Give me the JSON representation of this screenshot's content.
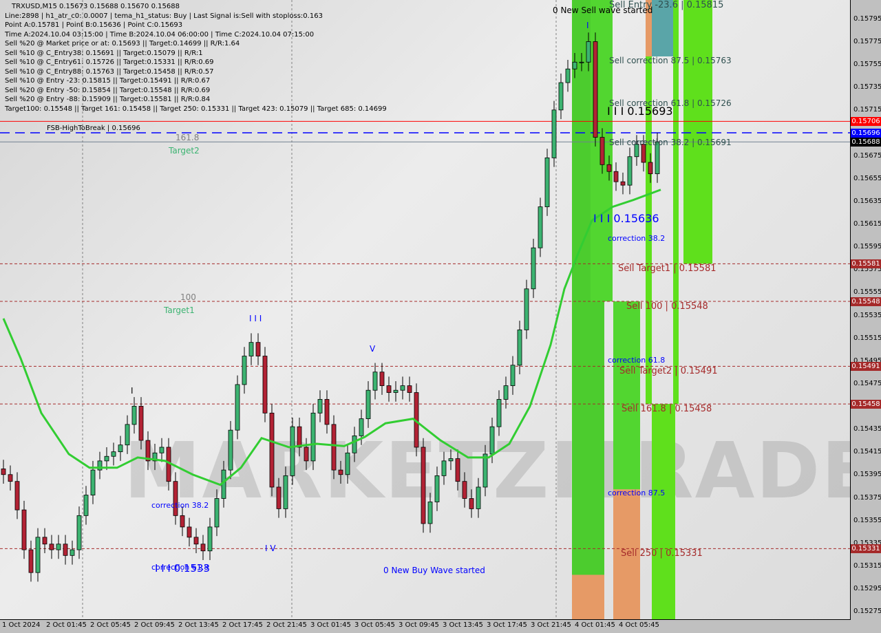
{
  "header": {
    "title": "TRXUSD,M15  0.15673 0.15688 0.15670 0.15688",
    "lines": [
      "Line:2898 | h1_atr_c0: 0.0007 | tema_h1_status: Buy | Last Signal is:Sell with stoploss:0.163",
      "Point A:0.15781 | Point B:0.15636 | Point C:0.15693",
      "Time A:2024.10.04 03:15:00 | Time B:2024.10.04 06:00:00 | Time C:2024.10.04 07:15:00",
      "Sell %20 @ Market price or at: 0.15693 || Target:0.14699 || R/R:1.64",
      "Sell %10 @ C_Entry38: 0.15691 || Target:0.15079 || R/R:1",
      "Sell %10 @ C_Entry61: 0.15726 || Target:0.15331 || R/R:0.69",
      "Sell %10 @ C_Entry88: 0.15763 || Target:0.15458 || R/R:0.57",
      "Sell %10 @ Entry -23: 0.15815 || Target:0.15491 || R/R:0.67",
      "Sell %20 @ Entry -50: 0.15854 || Target:0.15548 || R/R:0.69",
      "Sell %20 @ Entry -88: 0.15909 || Target:0.15581 || R/R:0.84",
      "Target100: 0.15548 || Target 161: 0.15458 || Target 250: 0.15331 || Target 423: 0.15079 || Target 685: 0.14699"
    ]
  },
  "watermark": "MARKETZITRADE",
  "labels": {
    "new_sell": "0 New Sell wave started",
    "sell_entry": "Sell Entry -23.6 | 0.15815",
    "sc875": "Sell correction 87.5 | 0.15763",
    "sc618": "Sell correction 61.8 | 0.15726",
    "pointC": "I I I 0.15693",
    "sc382": "Sell correction 38.2 | 0.15691",
    "pointB": "I I I 0.15636",
    "c382": "correction 38.2",
    "t1": "Sell Target1 | 0.15581",
    "s100": "Sell 100 | 0.15548",
    "c618": "correction 61.8",
    "t2": "Sell Target2 | 0.15491",
    "s1618": "Sell 161.8 | 0.15458",
    "c875": "correction 87.5",
    "s250": "Sell  250 | 0.15331",
    "fsb": "FSB-HighToBreak | 0.15696",
    "f1618": "161.8",
    "target2": "Target2",
    "f100": "100",
    "target1": "Target1",
    "w3": "I I I",
    "w5": "V",
    "w4": "I V",
    "w1": "I",
    "wtop": "I",
    "lc382": "correction 38.2",
    "lc618": "correction 61.8",
    "low": "I I I 0.1533",
    "new_buy": "0 New Buy Wave started"
  },
  "chart_data": {
    "type": "candlestick",
    "symbol": "TRXUSD",
    "timeframe": "M15",
    "ylim": [
      0.15265,
      0.15815
    ],
    "y_ticks": [
      "0.15795",
      "0.15775",
      "0.15755",
      "0.15735",
      "0.15715",
      "0.15695",
      "0.15675",
      "0.15655",
      "0.15635",
      "0.15615",
      "0.15595",
      "0.15575",
      "0.15555",
      "0.15535",
      "0.15515",
      "0.15495",
      "0.15475",
      "0.15455",
      "0.15435",
      "0.15415",
      "0.15395",
      "0.15375",
      "0.15355",
      "0.15335",
      "0.15315",
      "0.15295",
      "0.15275"
    ],
    "x_ticks": [
      "1 Oct 2024",
      "2 Oct 01:45",
      "2 Oct 05:45",
      "2 Oct 09:45",
      "2 Oct 13:45",
      "2 Oct 17:45",
      "2 Oct 21:45",
      "3 Oct 01:45",
      "3 Oct 05:45",
      "3 Oct 09:45",
      "3 Oct 13:45",
      "3 Oct 17:45",
      "3 Oct 21:45",
      "4 Oct 01:45",
      "4 Oct 05:45"
    ],
    "closes": [
      0.15396,
      0.1539,
      0.15365,
      0.1533,
      0.1531,
      0.15341,
      0.15335,
      0.1533,
      0.15335,
      0.15325,
      0.1533,
      0.1536,
      0.15378,
      0.154,
      0.15408,
      0.15412,
      0.15416,
      0.15422,
      0.1544,
      0.15456,
      0.15426,
      0.15408,
      0.15415,
      0.1542,
      0.1539,
      0.1536,
      0.1535,
      0.15341,
      0.15335,
      0.15329,
      0.1535,
      0.15375,
      0.154,
      0.15435,
      0.15475,
      0.155,
      0.15512,
      0.155,
      0.1545,
      0.15385,
      0.15366,
      0.15395,
      0.15438,
      0.1542,
      0.15408,
      0.1545,
      0.15462,
      0.1544,
      0.154,
      0.15396,
      0.15415,
      0.1543,
      0.15445,
      0.1547,
      0.15486,
      0.15474,
      0.15468,
      0.1547,
      0.15474,
      0.15468,
      0.1542,
      0.15353,
      0.15372,
      0.15395,
      0.15408,
      0.1541,
      0.1539,
      0.15375,
      0.15366,
      0.15385,
      0.15414,
      0.15438,
      0.15462,
      0.15474,
      0.15492,
      0.15523,
      0.15559,
      0.15595,
      0.15631,
      0.15674,
      0.15716,
      0.1574,
      0.15752,
      0.15758,
      0.15758,
      0.15776,
      0.15692,
      0.15668,
      0.15662,
      0.15653,
      0.1565,
      0.15675,
      0.15686,
      0.1567,
      0.1566,
      0.15688
    ],
    "moving_average": [
      [
        0,
        0.15533
      ],
      [
        2.5,
        0.15498
      ],
      [
        5.5,
        0.1545
      ],
      [
        9.5,
        0.15414
      ],
      [
        12.5,
        0.15402
      ],
      [
        16.5,
        0.15402
      ],
      [
        19.5,
        0.15411
      ],
      [
        23.5,
        0.15408
      ],
      [
        27.5,
        0.15396
      ],
      [
        31.5,
        0.15387
      ],
      [
        34.5,
        0.15402
      ],
      [
        37.5,
        0.15428
      ],
      [
        41.5,
        0.1542
      ],
      [
        45.5,
        0.15423
      ],
      [
        49.5,
        0.15421
      ],
      [
        52.5,
        0.15429
      ],
      [
        55.5,
        0.15441
      ],
      [
        59.5,
        0.15445
      ],
      [
        63.5,
        0.15426
      ],
      [
        67.5,
        0.15411
      ],
      [
        70.5,
        0.15411
      ],
      [
        73.5,
        0.15423
      ],
      [
        76.5,
        0.15456
      ],
      [
        79.5,
        0.1551
      ],
      [
        81.5,
        0.15559
      ],
      [
        83.5,
        0.1559
      ],
      [
        85.5,
        0.15619
      ],
      [
        88.5,
        0.15631
      ],
      [
        91.5,
        0.15637
      ],
      [
        95.5,
        0.15646
      ]
    ],
    "hlines": [
      {
        "price": 0.15706,
        "color": "#ff0000",
        "style": "solid",
        "tag": "0.15706"
      },
      {
        "price": 0.15696,
        "color": "#0000ff",
        "style": "dashed",
        "tag": "0.15696"
      },
      {
        "price": 0.15688,
        "color": "#708090",
        "style": "solid",
        "tag": "0.15688",
        "tag_color": "#000000"
      },
      {
        "price": 0.15581,
        "color": "#a52a2a",
        "style": "dotted",
        "tag": "0.15581"
      },
      {
        "price": 0.15548,
        "color": "#a52a2a",
        "style": "dotted",
        "tag": "0.15548"
      },
      {
        "price": 0.15491,
        "color": "#a52a2a",
        "style": "dotted",
        "tag": "0.15491"
      },
      {
        "price": 0.15458,
        "color": "#a52a2a",
        "style": "dotted",
        "tag": "0.15458"
      },
      {
        "price": 0.15331,
        "color": "#a52a2a",
        "style": "dotted",
        "tag": "0.15331"
      }
    ],
    "zones": [
      {
        "from": 82.6,
        "to": 87.3,
        "top": 0.15815,
        "bottom": 0.15308,
        "color": "#4ccc2e"
      },
      {
        "from": 82.6,
        "to": 87.3,
        "top": 0.15308,
        "bottom": 0.15265,
        "color": "#e69a66"
      },
      {
        "from": 85.3,
        "to": 88.5,
        "top": 0.15815,
        "bottom": 0.15548,
        "color": "#52d630"
      },
      {
        "from": 88.6,
        "to": 92.5,
        "top": 0.15548,
        "bottom": 0.15383,
        "color": "#52d630"
      },
      {
        "from": 88.6,
        "to": 92.5,
        "top": 0.15383,
        "bottom": 0.15265,
        "color": "#e69a66"
      },
      {
        "from": 93.3,
        "to": 94.2,
        "top": 0.15815,
        "bottom": 0.15763,
        "color": "#e69a66"
      },
      {
        "from": 93.3,
        "to": 94.2,
        "top": 0.15763,
        "bottom": 0.15458,
        "color": "#5fe01c"
      },
      {
        "from": 94.2,
        "to": 97.3,
        "top": 0.15815,
        "bottom": 0.15763,
        "color": "#5aa5a8"
      },
      {
        "from": 94.2,
        "to": 97.6,
        "top": 0.15458,
        "bottom": 0.15265,
        "color": "#5fe01c"
      },
      {
        "from": 97.3,
        "to": 98.1,
        "top": 0.15815,
        "bottom": 0.15458,
        "color": "#5fe01c"
      },
      {
        "from": 98.8,
        "to": 103,
        "top": 0.15815,
        "bottom": 0.15581,
        "color": "#5fe01c"
      }
    ],
    "colors": {
      "bull": "#3cb371",
      "bear": "#b22234",
      "ma": "#32cd32",
      "envelope": "#ff4500"
    }
  }
}
